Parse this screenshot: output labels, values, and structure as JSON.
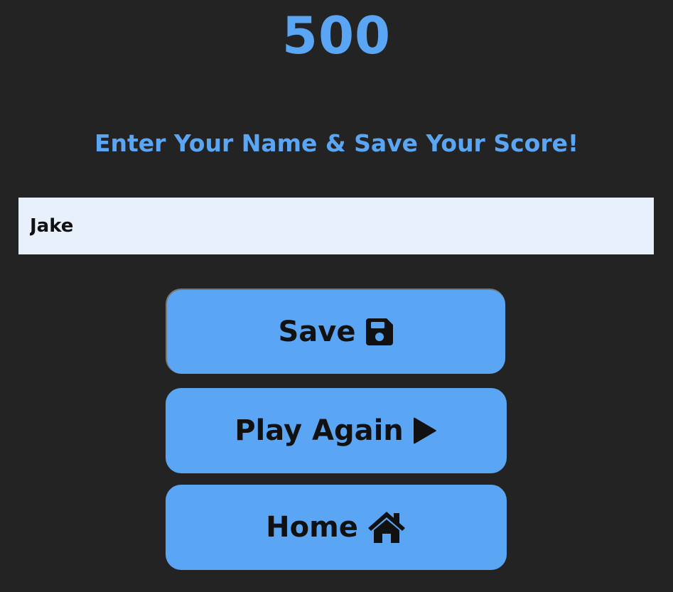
{
  "score": {
    "value": "500"
  },
  "prompt": {
    "text": "Enter Your Name & Save Your Score!"
  },
  "name_input": {
    "value": "Jake"
  },
  "buttons": {
    "save": {
      "label": "Save",
      "icon": "floppy-disk-icon"
    },
    "play_again": {
      "label": "Play Again",
      "icon": "play-icon"
    },
    "home": {
      "label": "Home",
      "icon": "home-icon"
    }
  },
  "colors": {
    "background": "#232323",
    "accent": "#5aa6f5",
    "input_background": "#e8f0fb",
    "button_text": "#111111"
  }
}
